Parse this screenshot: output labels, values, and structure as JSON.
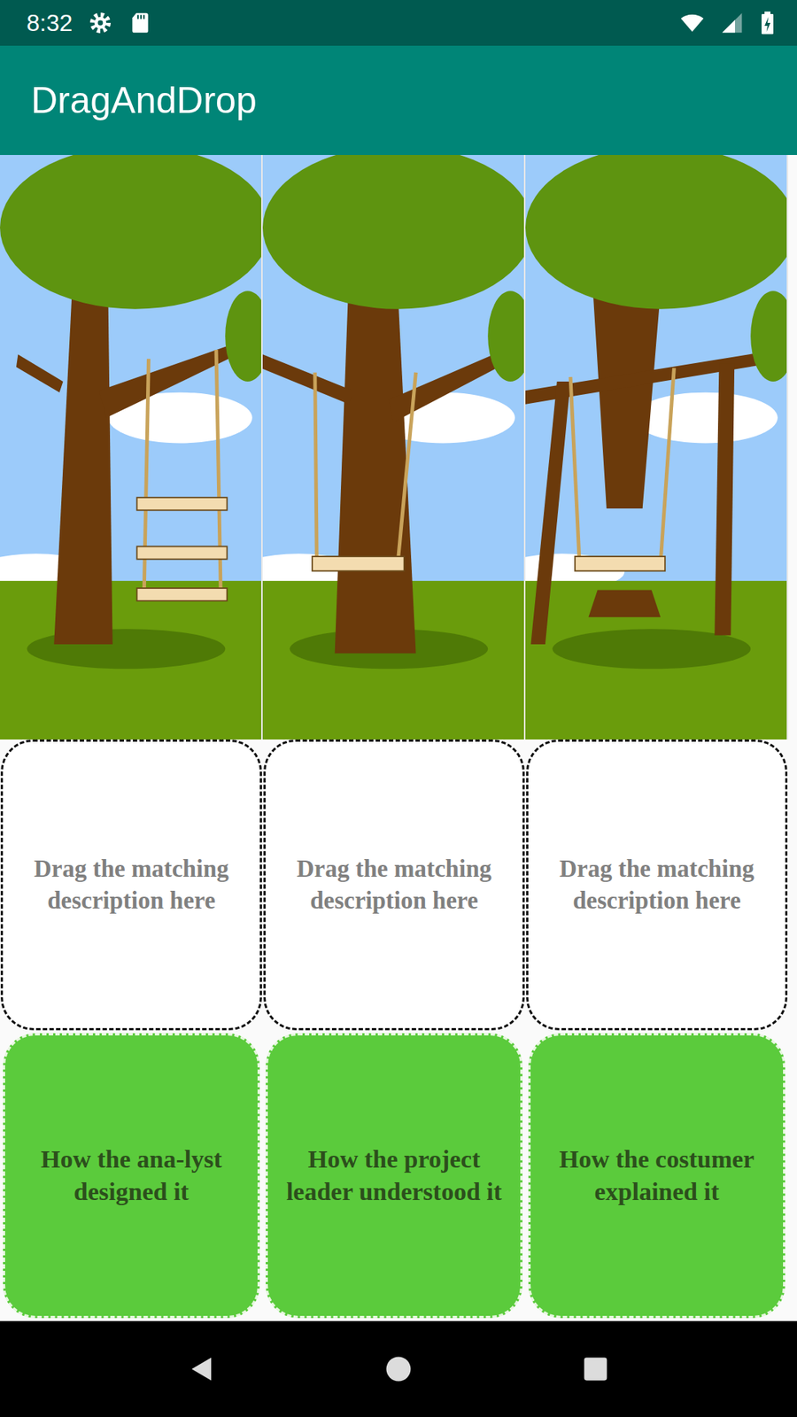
{
  "status_bar": {
    "time": "8:32"
  },
  "app_bar": {
    "title": "DragAndDrop"
  },
  "panels": [
    {
      "kind": "ladder",
      "drop_hint": "Drag the matching description here"
    },
    {
      "kind": "trunk",
      "drop_hint": "Drag the matching description here"
    },
    {
      "kind": "propped",
      "drop_hint": "Drag the matching description here"
    }
  ],
  "cards": [
    {
      "text": "How the ana-lyst designed it"
    },
    {
      "text": "How the project leader understood it"
    },
    {
      "text": "How the costumer explained it"
    }
  ]
}
